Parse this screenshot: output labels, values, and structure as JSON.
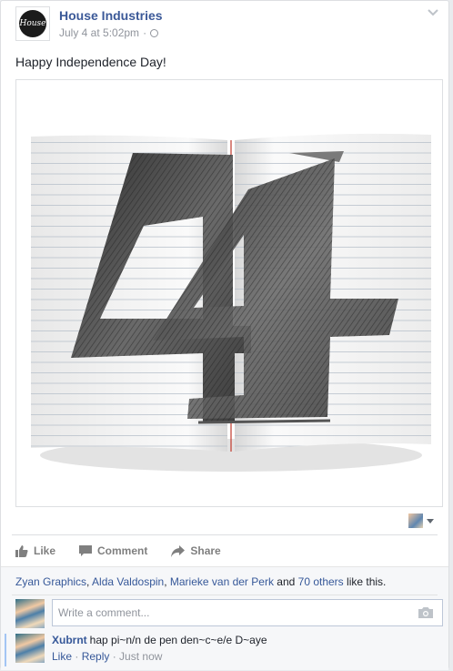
{
  "post": {
    "page_name": "House Industries",
    "avatar_text": "House",
    "timestamp": "July 4 at 5:02pm",
    "separator": "·",
    "status_text": "Happy Independence Day!"
  },
  "photo": {
    "subject": "Pencil sketch of the number 4 on notebook pages"
  },
  "actions": {
    "like": "Like",
    "comment": "Comment",
    "share": "Share"
  },
  "likes": {
    "name1": "Zyan Graphics",
    "sep1": ", ",
    "name2": "Alda Valdospin",
    "sep2": ", ",
    "name3": "Marieke van der Perk",
    "and": " and ",
    "others": "70 others",
    "suffix": " like this."
  },
  "composer": {
    "placeholder": "Write a comment..."
  },
  "comment": {
    "author": "Xubrnt",
    "text": "hap pi~n/n de pen den~c~e/e D~aye",
    "like": "Like",
    "sep": " · ",
    "reply": "Reply",
    "time": "Just now"
  },
  "colors": {
    "link": "#365899",
    "name": "#3b5998",
    "muted": "#90949c"
  }
}
